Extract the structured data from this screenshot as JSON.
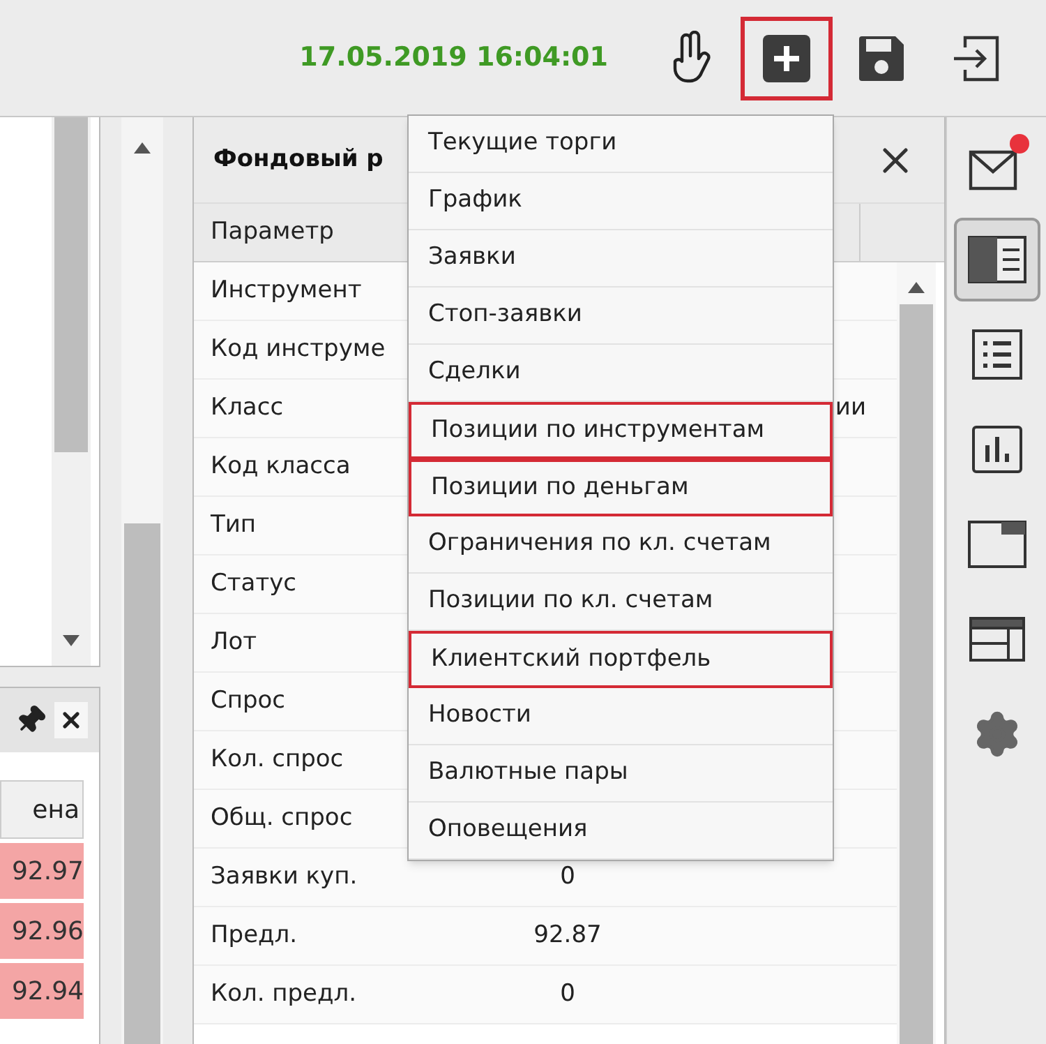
{
  "header": {
    "datetime": "17.05.2019 16:04:01",
    "buttons": [
      {
        "kind": "hand",
        "highlighted": false
      },
      {
        "kind": "add",
        "highlighted": true
      },
      {
        "kind": "save",
        "highlighted": false
      },
      {
        "kind": "exit",
        "highlighted": false
      }
    ]
  },
  "order_book": {
    "column": "ена",
    "rows": [
      {
        "price": "92.97"
      },
      {
        "price": "92.96"
      },
      {
        "price": "92.94"
      }
    ]
  },
  "quote_panel": {
    "title": "Фондовый р",
    "column": "Параметр",
    "rows": [
      {
        "label": "Инструмент"
      },
      {
        "label": "Код инструме"
      },
      {
        "label": "Класс",
        "value": "ии",
        "kind": "overflow"
      },
      {
        "label": "Код класса"
      },
      {
        "label": "Тип"
      },
      {
        "label": "Статус"
      },
      {
        "label": "Лот"
      },
      {
        "label": "Спрос"
      },
      {
        "label": "Кол. спрос"
      },
      {
        "label": "Общ. спрос"
      },
      {
        "label": "Заявки куп.",
        "value": "0",
        "kind": "plain"
      },
      {
        "label": "Предл.",
        "value": "92.87",
        "kind": "plain"
      },
      {
        "label": "Кол. предл.",
        "value": "0",
        "kind": "plain"
      }
    ]
  },
  "add_menu": {
    "items": [
      {
        "label": "Текущие торги",
        "highlighted": false
      },
      {
        "label": "График",
        "highlighted": false
      },
      {
        "label": "Заявки",
        "highlighted": false
      },
      {
        "label": "Стоп-заявки",
        "highlighted": false
      },
      {
        "label": "Сделки",
        "highlighted": false
      },
      {
        "label": "Позиции по инструментам",
        "highlighted": true
      },
      {
        "label": "Позиции по деньгам",
        "highlighted": true
      },
      {
        "label": "Ограничения по кл. счетам",
        "highlighted": false
      },
      {
        "label": "Позиции по кл. счетам",
        "highlighted": false
      },
      {
        "label": "Клиентский портфель",
        "highlighted": true
      },
      {
        "label": "Новости",
        "highlighted": false
      },
      {
        "label": "Валютные пары",
        "highlighted": false
      },
      {
        "label": "Оповещения",
        "highlighted": false
      }
    ]
  },
  "sidebar": [
    {
      "kind": "mail",
      "selected": false,
      "notification": true
    },
    {
      "kind": "panel",
      "selected": true
    },
    {
      "kind": "list",
      "selected": false
    },
    {
      "kind": "chart",
      "selected": false
    },
    {
      "kind": "window",
      "selected": false
    },
    {
      "kind": "layout",
      "selected": false
    },
    {
      "kind": "settings",
      "selected": false
    }
  ]
}
